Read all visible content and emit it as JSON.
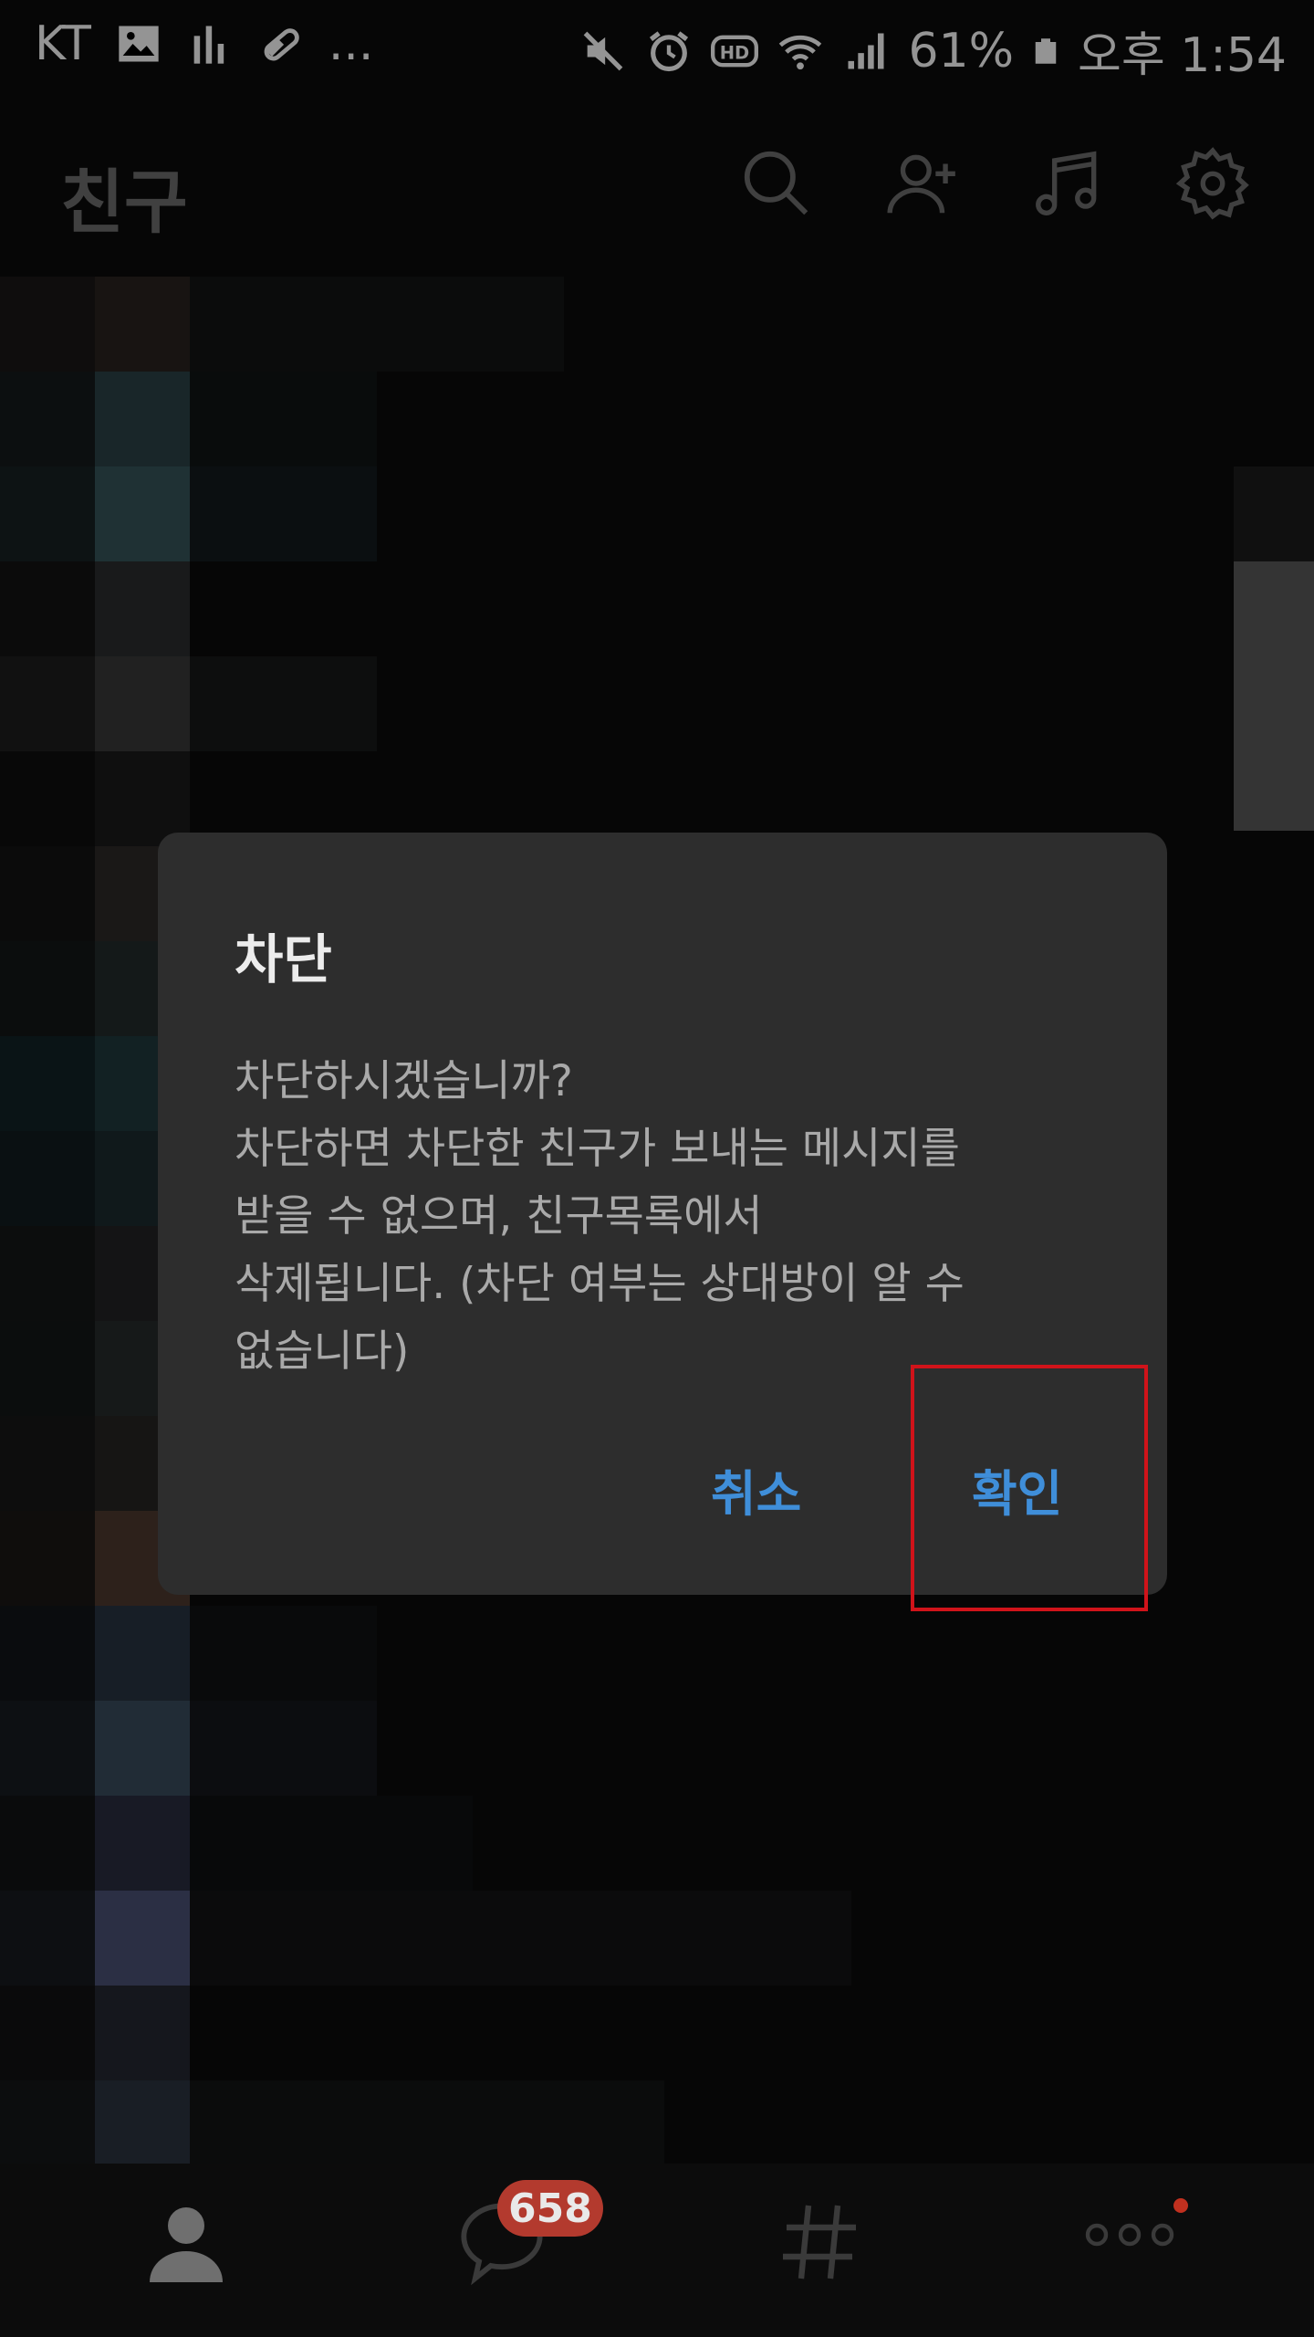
{
  "status_bar": {
    "carrier": "KT",
    "overflow": "...",
    "battery": "61%",
    "time": "오후 1:54",
    "icons": [
      "image-icon",
      "bars-icon",
      "pill-icon",
      "mute-icon",
      "alarm-icon",
      "hd-icon",
      "wifi-icon",
      "signal-icon",
      "battery-icon"
    ]
  },
  "header": {
    "title": "친구",
    "icons": [
      "search-icon",
      "add-friend-icon",
      "music-icon",
      "settings-icon"
    ]
  },
  "dialog": {
    "title": "차단",
    "body_lines": [
      "차단하시겠습니까?",
      "차단하면 차단한 친구가 보내는 메시지를",
      "받을 수 없으며, 친구목록에서",
      "삭제됩니다. (차단 여부는 상대방이 알 수",
      "없습니다)"
    ],
    "cancel_label": "취소",
    "confirm_label": "확인"
  },
  "bottom_nav": {
    "items": [
      "friends-tab",
      "chats-tab",
      "hashtag-tab",
      "more-tab"
    ],
    "chat_badge": "658"
  },
  "colors": {
    "accent": "#3f8ed9",
    "badge": "#b33a2e",
    "dialog_bg": "#2d2d2d",
    "highlight": "#d0131a"
  }
}
